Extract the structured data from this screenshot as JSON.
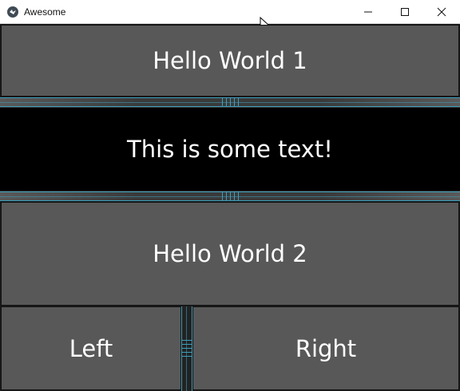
{
  "window": {
    "title": "Awesome",
    "controls": {
      "minimize_icon": "minimize-icon",
      "maximize_icon": "maximize-icon",
      "close_icon": "close-icon"
    }
  },
  "panels": {
    "top_label": "Hello World 1",
    "middle_text": "This is some text!",
    "second_label": "Hello World 2",
    "left_label": "Left",
    "right_label": "Right"
  },
  "colors": {
    "panel_bg": "#585858",
    "splitter_accent": "#3c9fbd",
    "text_area_bg": "#000000",
    "text_color": "#ffffff"
  }
}
